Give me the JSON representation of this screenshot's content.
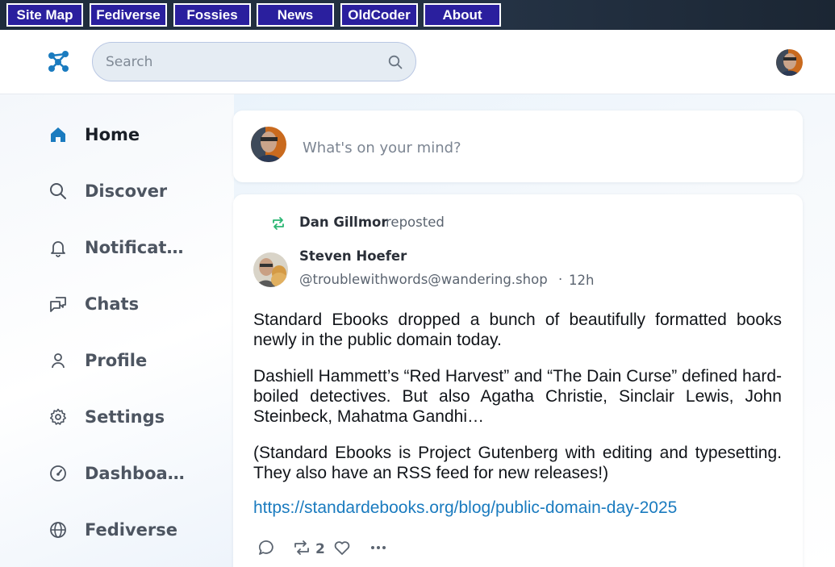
{
  "topnav": {
    "items": [
      {
        "label": "Site Map"
      },
      {
        "label": "Fediverse"
      },
      {
        "label": "Fossies"
      },
      {
        "label": "News"
      },
      {
        "label": "OldCoder"
      },
      {
        "label": "About"
      }
    ]
  },
  "header": {
    "search_placeholder": "Search",
    "logo_icon": "network-logo-icon",
    "accent_color": "#1a7bbf"
  },
  "sidebar": {
    "items": [
      {
        "label": "Home",
        "icon": "home-icon",
        "active": true
      },
      {
        "label": "Discover",
        "icon": "search-icon"
      },
      {
        "label": "Notifications",
        "icon": "bell-icon"
      },
      {
        "label": "Chats",
        "icon": "chats-icon"
      },
      {
        "label": "Profile",
        "icon": "user-icon"
      },
      {
        "label": "Settings",
        "icon": "gear-icon"
      },
      {
        "label": "Dashboard",
        "icon": "dashboard-icon"
      },
      {
        "label": "Fediverse",
        "icon": "globe-icon"
      }
    ]
  },
  "compose": {
    "placeholder": "What's on your mind?"
  },
  "post": {
    "reposted_by": "Dan Gillmor",
    "reposted_text": "reposted",
    "author_name": "Steven Hoefer",
    "author_handle": "@troublewithwords@wandering.shop",
    "separator": "·",
    "time": "12h",
    "paragraphs": [
      "Standard Ebooks dropped a bunch of beautifully formatted books newly in the public domain today.",
      "Dashiell Hammett’s “Red Harvest” and “The Dain Curse” defined hard-boiled detectives. But also Agatha Christie, Sinclair Lewis, John Steinbeck, Mahatma Gandhi…",
      "(Standard Ebooks is Project Gutenberg with editing and typesetting. They also have an RSS feed for new releases!)"
    ],
    "link": "https://standardebooks.org/blog/public-domain-day-2025",
    "reblog_count": "2",
    "repost_color": "#2bb673"
  }
}
